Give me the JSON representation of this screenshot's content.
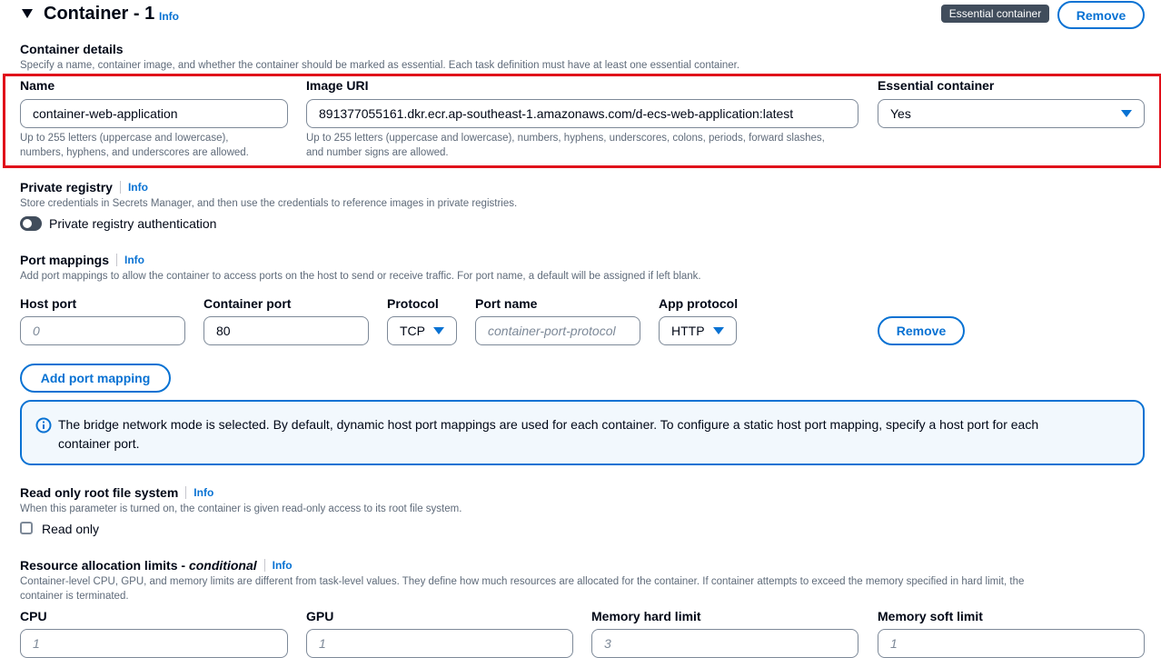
{
  "container": {
    "title": "Container - 1",
    "info": "Info",
    "essential_badge": "Essential container",
    "remove_label": "Remove"
  },
  "details": {
    "heading": "Container details",
    "description": "Specify a name, container image, and whether the container should be marked as essential. Each task definition must have at least one essential container.",
    "name_label": "Name",
    "name_value": "container-web-application",
    "name_hint_1": "Up to 255 letters (uppercase and lowercase),",
    "name_hint_2": "numbers, hyphens, and underscores are allowed.",
    "image_label": "Image URI",
    "image_value": "891377055161.dkr.ecr.ap-southeast-1.amazonaws.com/d-ecs-web-application:latest",
    "image_hint_1": "Up to 255 letters (uppercase and lowercase), numbers, hyphens, underscores, colons, periods, forward slashes,",
    "image_hint_2": "and number signs are allowed.",
    "essential_label": "Essential container",
    "essential_value": "Yes"
  },
  "registry": {
    "heading": "Private registry",
    "info": "Info",
    "description": "Store credentials in Secrets Manager, and then use the credentials to reference images in private registries.",
    "toggle_label": "Private registry authentication"
  },
  "ports": {
    "heading": "Port mappings",
    "info": "Info",
    "description": "Add port mappings to allow the container to access ports on the host to send or receive traffic. For port name, a default will be assigned if left blank.",
    "host_label": "Host port",
    "host_placeholder": "0",
    "container_label": "Container port",
    "container_value": "80",
    "protocol_label": "Protocol",
    "protocol_value": "TCP",
    "portname_label": "Port name",
    "portname_placeholder": "container-port-protocol",
    "app_label": "App protocol",
    "app_value": "HTTP",
    "remove_label": "Remove",
    "add_label": "Add port mapping"
  },
  "alert": {
    "line1": "The bridge network mode is selected. By default, dynamic host port mappings are used for each container. To configure a static host port mapping, specify a host port for each",
    "line2": "container port."
  },
  "readonly": {
    "heading": "Read only root file system",
    "info": "Info",
    "description": "When this parameter is turned on, the container is given read-only access to its root file system.",
    "checkbox_label": "Read only"
  },
  "resources": {
    "heading": "Resource allocation limits -",
    "heading_em": "conditional",
    "info": "Info",
    "description_1": "Container-level CPU, GPU, and memory limits are different from task-level values. They define how much resources are allocated for the container. If container attempts to exceed the memory specified in hard limit, the",
    "description_2": "container is terminated.",
    "cpu_label": "CPU",
    "cpu_placeholder": "1",
    "gpu_label": "GPU",
    "gpu_placeholder": "1",
    "hard_label": "Memory hard limit",
    "hard_placeholder": "3",
    "soft_label": "Memory soft limit",
    "soft_placeholder": "1"
  },
  "colors": {
    "accent": "#0972d3",
    "highlight": "#e0101a",
    "alert_bg": "#f2f8fd",
    "badge_bg": "#414d5c"
  }
}
